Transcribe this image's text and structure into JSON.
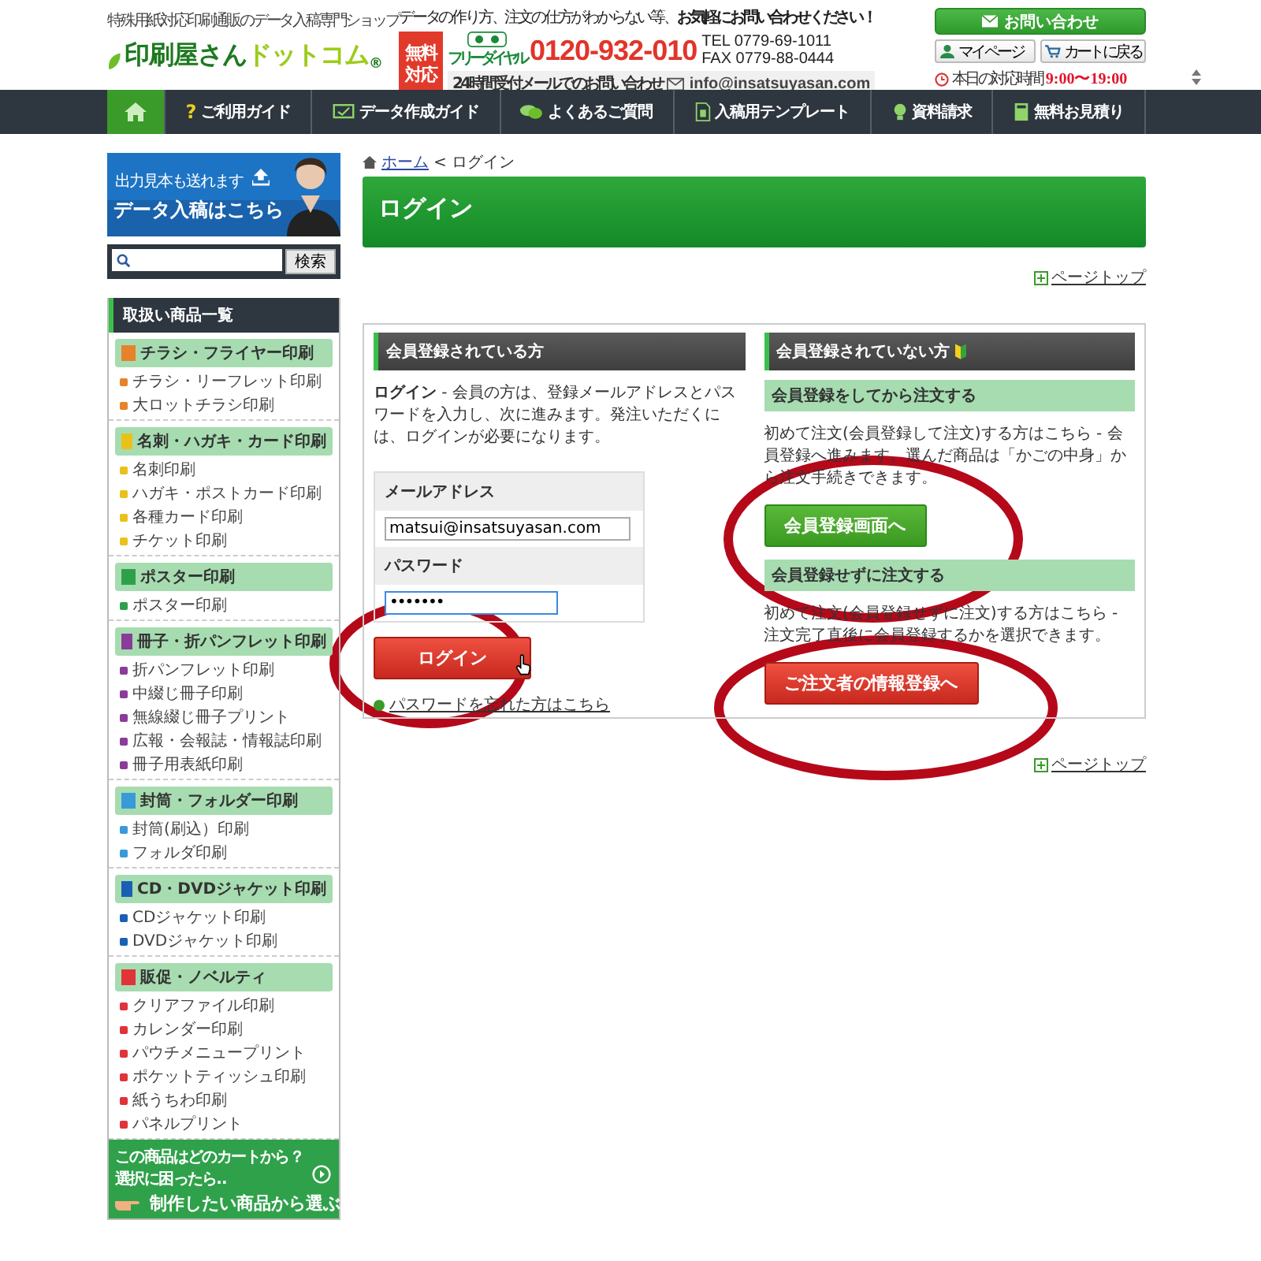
{
  "header": {
    "tagline": "特殊用紙対応印刷通販のデータ入稿専門ショップ",
    "logo": {
      "main": "印刷屋さん",
      "accent": "ドットコム",
      "mark": "®"
    },
    "contact": {
      "notice": "データの作り方、注文の仕方がわからない等、",
      "notice_strong": "お気軽にお問い合わせください！",
      "free_badge": [
        "無料",
        "対応"
      ],
      "freedial_label": "フリーダイヤル",
      "phone": "0120-932-010",
      "tel": "TEL  0779-69-1011",
      "fax": "FAX  0779-88-0444",
      "mail_note": "24時間受付メールでのお問い合わせ",
      "email": "info@insatsuyasan.com"
    },
    "inquiry_button": "お問い合わせ",
    "mypage_button": "マイページ",
    "cart_button": "カートに戻る",
    "hours_label": "本日の対応時間",
    "hours": "9:00〜19:00"
  },
  "nav": [
    {
      "kind": "home",
      "selected": true
    },
    {
      "kind": "guide",
      "label": "ご利用ガイド",
      "icon_text": "?",
      "selected": false
    },
    {
      "kind": "data",
      "label": "データ作成ガイド",
      "selected": false
    },
    {
      "kind": "faq",
      "label": "よくあるご質問",
      "selected": false
    },
    {
      "kind": "template",
      "label": "入稿用テンプレート",
      "selected": false
    },
    {
      "kind": "request",
      "label": "資料請求",
      "selected": false
    },
    {
      "kind": "estimate",
      "label": "無料お見積り",
      "selected": false
    }
  ],
  "sidebar": {
    "banner": {
      "kind": "picture",
      "line1": "出力見本も送れます",
      "line2": "データ入稿はこちら"
    },
    "search_button": "検索",
    "categories_title": "取扱い商品一覧",
    "groups": [
      {
        "title": "チラシ・フライヤー印刷",
        "color": "#e8822a",
        "items": [
          "チラシ・リーフレット印刷",
          "大ロットチラシ印刷"
        ]
      },
      {
        "title": "名刺・ハガキ・カード印刷",
        "color": "#e8c21a",
        "items": [
          "名刺印刷",
          "ハガキ・ポストカード印刷",
          "各種カード印刷",
          "チケット印刷"
        ]
      },
      {
        "title": "ポスター印刷",
        "color": "#2fa04a",
        "items": [
          "ポスター印刷"
        ]
      },
      {
        "title": "冊子・折パンフレット印刷",
        "color": "#8a3c9a",
        "items": [
          "折パンフレット印刷",
          "中綴じ冊子印刷",
          "無線綴じ冊子プリント",
          "広報・会報誌・情報誌印刷",
          "冊子用表紙印刷"
        ]
      },
      {
        "title": "封筒・フォルダー印刷",
        "color": "#3a9ad8",
        "items": [
          "封筒(刷込）印刷",
          "フォルダ印刷"
        ]
      },
      {
        "title": "CD・DVDジャケット印刷",
        "color": "#1a5fb4",
        "items": [
          "CDジャケット印刷",
          "DVDジャケット印刷"
        ]
      },
      {
        "title": "販促・ノベルティ",
        "color": "#e0333a",
        "items": [
          "クリアファイル印刷",
          "カレンダー印刷",
          "パウチメニュープリント",
          "ポケットティッシュ印刷",
          "紙うちわ印刷",
          "パネルプリント"
        ]
      }
    ],
    "cart_help": {
      "line1": "この商品はどのカートから？",
      "line2": "選択に困ったら‥",
      "link": "制作したい商品から選ぶ"
    }
  },
  "breadcrumb": [
    "ホーム",
    "ログイン"
  ],
  "breadcrumb_separator": "<",
  "page_title": "ログイン",
  "page_top_links": [
    "ページトップ",
    "ページトップ"
  ],
  "member": {
    "heading": "会員登録されている方",
    "intro": "**ログイン** - 会員の方は、登録メールアドレスとパスワードを入力し、次に進みます。発注いただくには、ログインが必要になります。",
    "email_label": "メールアドレス",
    "email_value": "matsui@insatsuyasan.com",
    "password_label": "パスワード",
    "password_value": "•••••••",
    "login_button": "ログイン",
    "forgot_link": "パスワードを忘れた方はこちら"
  },
  "guest": {
    "heading": "会員登録されていない方",
    "sections": [
      {
        "title": "会員登録をしてから注文する",
        "text": "初めて注文(会員登録して注文)する方はこちら - 会員登録へ進みます。選んだ商品は「かごの中身」から注文手続きできます。",
        "button": "会員登録画面へ",
        "kind": "green"
      },
      {
        "title": "会員登録せずに注文する",
        "text": "初めて注文(会員登録せずに注文)する方はこちら - 注文完了直後に会員登録するかを選択できます。",
        "button": "ご注文者の情報登録へ",
        "kind": "red"
      }
    ]
  }
}
